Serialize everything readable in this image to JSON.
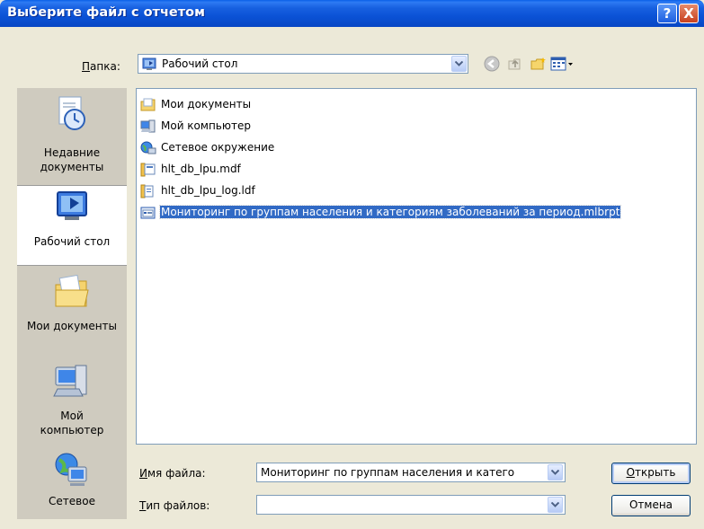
{
  "window": {
    "title": "Выберите файл с отчетом",
    "help_label": "?",
    "close_label": "X"
  },
  "lookin": {
    "label_accel": "П",
    "label_rest": "апка:",
    "value": "Рабочий стол",
    "icon": "desktop-icon"
  },
  "nav": {
    "icons": [
      "back-icon",
      "up-folder-icon",
      "new-folder-icon",
      "views-menu-icon"
    ]
  },
  "places": [
    {
      "label_line1": "Недавние",
      "label_line2": "документы",
      "icon": "recent-documents-icon"
    },
    {
      "label_line1": "Рабочий стол",
      "label_line2": "",
      "icon": "desktop-icon"
    },
    {
      "label_line1": "Мои документы",
      "label_line2": "",
      "icon": "my-documents-icon"
    },
    {
      "label_line1": "Мой",
      "label_line2": "компьютер",
      "icon": "my-computer-icon"
    },
    {
      "label_line1": "Сетевое",
      "label_line2": "",
      "icon": "network-icon"
    }
  ],
  "files": [
    {
      "name": "Мои документы",
      "icon": "folder-documents-icon"
    },
    {
      "name": "Мой компьютер",
      "icon": "computer-icon"
    },
    {
      "name": "Сетевое окружение",
      "icon": "network-places-icon"
    },
    {
      "name": "hlt_db_lpu.mdf",
      "icon": "mdf-file-icon"
    },
    {
      "name": "hlt_db_lpu_log.ldf",
      "icon": "ldf-file-icon"
    },
    {
      "name": "Мониторинг по группам населения и категориям заболеваний за период.mlbrpt",
      "icon": "report-file-icon"
    }
  ],
  "filename": {
    "label_accel": "И",
    "label_rest": "мя файла:",
    "value": "Мониторинг по группам населения и катего"
  },
  "filetype": {
    "label_accel": "Т",
    "label_rest": "ип файлов:",
    "value": ""
  },
  "buttons": {
    "open_accel": "О",
    "open_rest": "ткрыть",
    "cancel": "Отмена"
  },
  "colors": {
    "titlebar": "#0B52D6",
    "selection": "#316AC5",
    "dialog_bg": "#ECE9D8",
    "places_bg": "#CFCBBF"
  }
}
